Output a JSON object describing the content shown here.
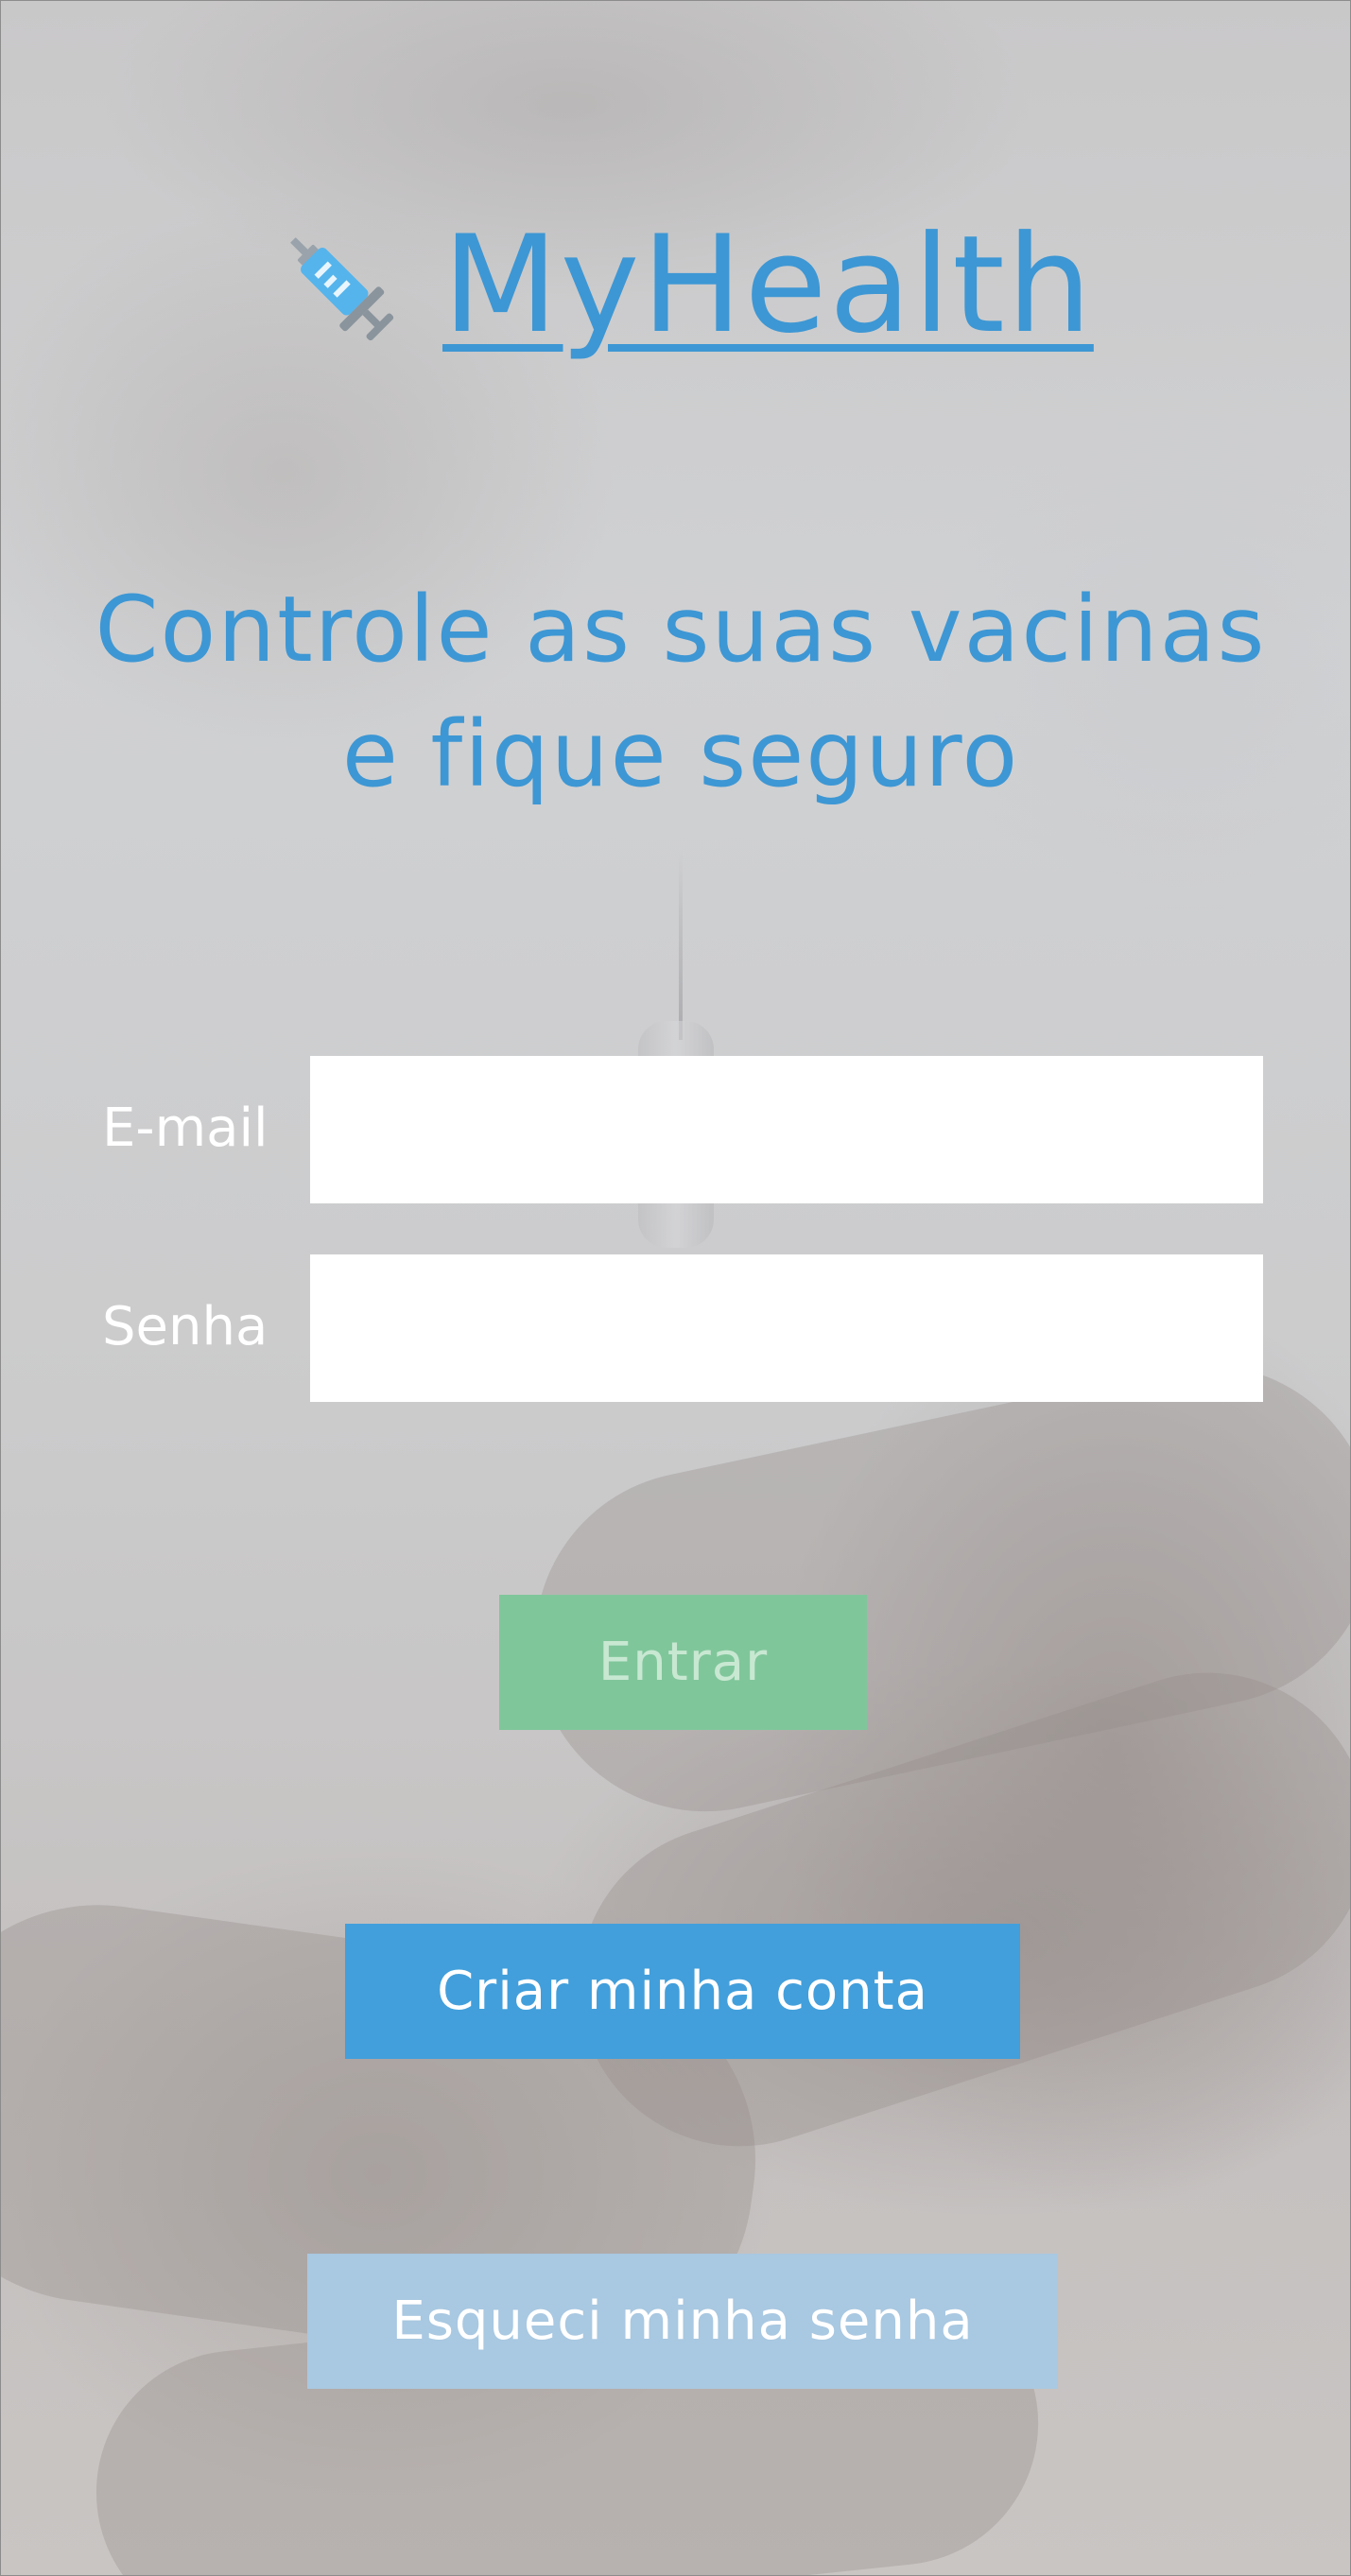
{
  "app": {
    "brand": "MyHealth",
    "logo_icon": "syringe-icon",
    "headline": "Controle as suas vacinas e fique seguro"
  },
  "login_form": {
    "email_label": "E-mail",
    "email_value": "",
    "password_label": "Senha",
    "password_value": "",
    "submit_label": "Entrar"
  },
  "actions": {
    "create_account_label": "Criar minha conta",
    "forgot_password_label": "Esqueci minha senha"
  },
  "colors": {
    "brand_blue": "#3d97d4",
    "login_green": "#80c69b",
    "signup_blue": "#429fdb",
    "forgot_light_blue": "#a9c8e1"
  }
}
